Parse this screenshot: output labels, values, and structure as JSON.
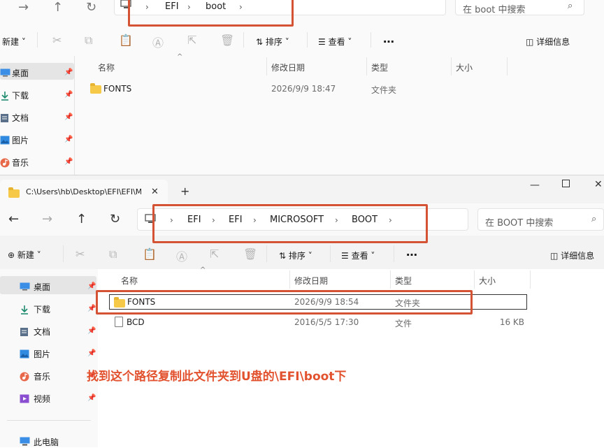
{
  "window1": {
    "breadcrumb": [
      "EFI",
      "boot"
    ],
    "search_placeholder": "在 boot 中搜索",
    "toolbar": {
      "new_label": "新建",
      "sort_label": "排序",
      "view_label": "查看",
      "more_label": "…",
      "details_label": "详细信息"
    },
    "columns": [
      "名称",
      "修改日期",
      "类型",
      "大小"
    ],
    "nav": [
      {
        "label": "桌面",
        "icon": "desktop-icon"
      },
      {
        "label": "下载",
        "icon": "download-icon"
      },
      {
        "label": "文档",
        "icon": "document-icon"
      },
      {
        "label": "图片",
        "icon": "picture-icon"
      },
      {
        "label": "音乐",
        "icon": "music-icon"
      }
    ],
    "rows": [
      {
        "name": "FONTS",
        "modified": "2026/9/9 18:47",
        "type": "文件夹",
        "size": "",
        "icon": "folder-icon"
      }
    ]
  },
  "window2": {
    "tab_title": "C:\\Users\\hb\\Desktop\\EFI\\EFI\\M",
    "breadcrumb": [
      "EFI",
      "EFI",
      "MICROSOFT",
      "BOOT"
    ],
    "search_placeholder": "在 BOOT 中搜索",
    "toolbar": {
      "new_label": "新建",
      "sort_label": "排序",
      "view_label": "查看",
      "more_label": "…",
      "details_label": "详细信息"
    },
    "columns": [
      "名称",
      "修改日期",
      "类型",
      "大小"
    ],
    "nav": [
      {
        "label": "桌面",
        "icon": "desktop-icon"
      },
      {
        "label": "下载",
        "icon": "download-icon"
      },
      {
        "label": "文档",
        "icon": "document-icon"
      },
      {
        "label": "图片",
        "icon": "picture-icon"
      },
      {
        "label": "音乐",
        "icon": "music-icon"
      },
      {
        "label": "视频",
        "icon": "video-icon"
      },
      {
        "label": "此电脑",
        "icon": "computer-icon"
      }
    ],
    "rows": [
      {
        "name": "FONTS",
        "modified": "2026/9/9 18:54",
        "type": "文件夹",
        "size": "",
        "icon": "folder-icon"
      },
      {
        "name": "BCD",
        "modified": "2016/5/5 17:30",
        "type": "文件",
        "size": "16 KB",
        "icon": "file-icon"
      }
    ]
  },
  "annotation": "找到这个路径复制此文件夹到U盘的\\EFI\\boot下",
  "colors": {
    "annotation_red": "#e2522f",
    "highlight_box": "#d45335"
  }
}
